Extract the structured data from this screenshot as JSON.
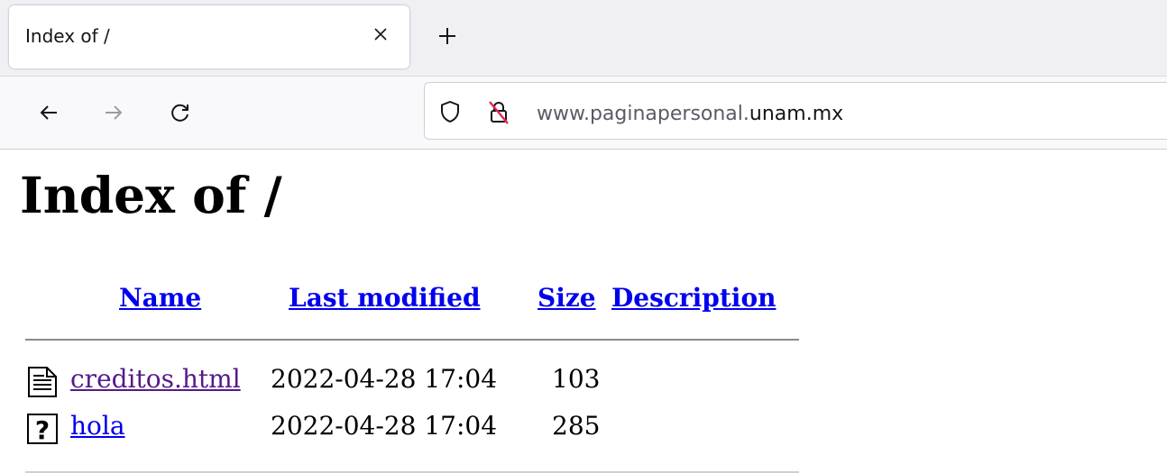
{
  "browser": {
    "tab_title": "Index of /",
    "url_prefix": "www.paginapersonal.",
    "url_domain": "unam.mx"
  },
  "page": {
    "heading": "Index of /",
    "columns": {
      "name": "Name",
      "last_modified": "Last modified",
      "size": "Size",
      "description": "Description"
    },
    "files": [
      {
        "icon": "text-file-icon",
        "name": "creditos.html",
        "modified": "2022-04-28 17:04",
        "size": "103",
        "description": "",
        "visited": true
      },
      {
        "icon": "unknown-file-icon",
        "name": "hola",
        "modified": "2022-04-28 17:04",
        "size": "285",
        "description": "",
        "visited": false
      }
    ]
  },
  "colors": {
    "link": "#0000ee",
    "visited_link": "#551a8b",
    "rule": "#8a8a8a"
  }
}
